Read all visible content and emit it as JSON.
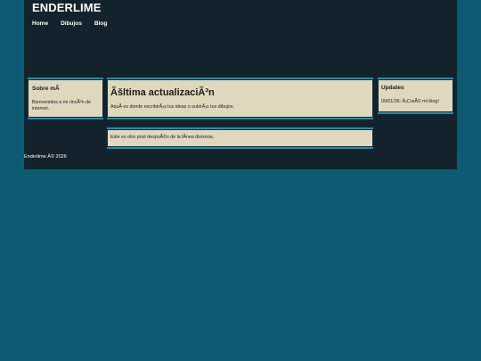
{
  "site": {
    "title": "ENDERLIME"
  },
  "nav": {
    "items": [
      {
        "label": "Home"
      },
      {
        "label": "Dibujos"
      },
      {
        "label": "Blog"
      }
    ]
  },
  "about": {
    "title": "Sobre mÃ",
    "text": "Bienvenidos a mi rincÃ³n de internet."
  },
  "main_post": {
    "title": "Ãšltima actualizaciÃ³n",
    "text": "AquÃ es donde escribirÃ¡s tus ideas o subirÃ¡s tus dibujos."
  },
  "updates": {
    "title": "Updates",
    "text": "09/01/26: Â¡CreÃ© mi blog!"
  },
  "second_post": {
    "text": "Este es otro post despuÃ©s de la lÃnea divisoria."
  },
  "footer": {
    "text": "Enderlime Â© 2026"
  },
  "colors": {
    "background": "#0e5a73",
    "page": "#13232b",
    "card": "#e0d8bc",
    "card_border": "#2a8aa8"
  }
}
